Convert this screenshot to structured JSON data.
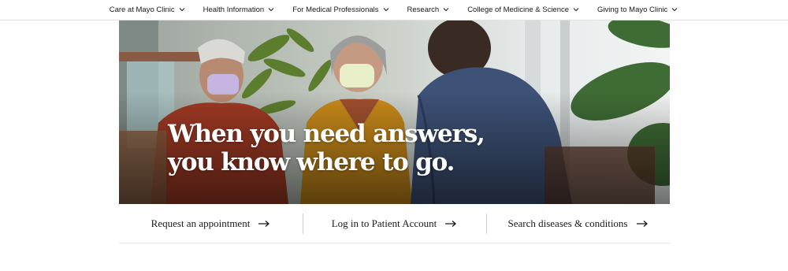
{
  "nav": {
    "items": [
      {
        "label": "Care at Mayo Clinic"
      },
      {
        "label": "Health Information"
      },
      {
        "label": "For Medical Professionals"
      },
      {
        "label": "Research"
      },
      {
        "label": "College of Medicine & Science"
      },
      {
        "label": "Giving to Mayo Clinic"
      }
    ],
    "chevron_icon": "chevron-down-icon"
  },
  "hero": {
    "headline_line1": "When you need answers,",
    "headline_line2": "you know where to go."
  },
  "quick_links": [
    {
      "label": "Request an appointment",
      "icon": "arrow-right-icon"
    },
    {
      "label": "Log in to Patient Account",
      "icon": "arrow-right-icon"
    },
    {
      "label": "Search diseases & conditions",
      "icon": "arrow-right-icon"
    }
  ],
  "colors": {
    "text": "#1a1a1a",
    "divider": "#e3e3e3",
    "hero_text": "#ffffff"
  }
}
